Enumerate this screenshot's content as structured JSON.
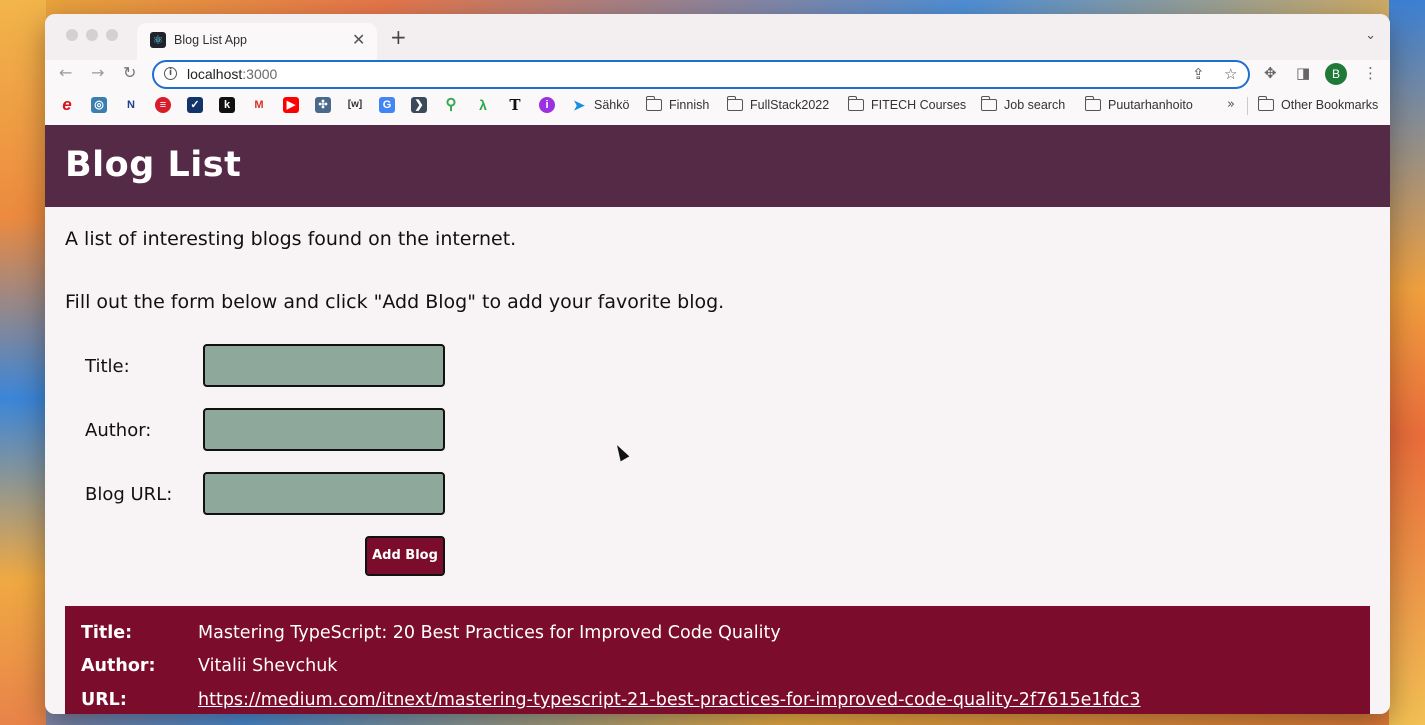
{
  "browser": {
    "tab_title": "Blog List App",
    "url_host": "localhost",
    "url_port": ":3000",
    "profile_initial": "B",
    "bookmarks": {
      "sahko": "Sähkö",
      "finnish": "Finnish",
      "fullstack": "FullStack2022",
      "fitech": "FITECH Courses",
      "job_search": "Job search",
      "puutarha": "Puutarhanhoito",
      "more": "»",
      "other": "Other Bookmarks"
    }
  },
  "page": {
    "title": "Blog List",
    "intro": "A list of interesting blogs found on the internet.",
    "instruction": "Fill out the form below and click \"Add Blog\" to add your favorite blog.",
    "form": {
      "title_label": "Title:",
      "author_label": "Author:",
      "url_label": "Blog URL:",
      "title_value": "",
      "author_value": "",
      "url_value": "",
      "submit_label": "Add Blog"
    },
    "blogs": [
      {
        "title_label": "Title:",
        "title": "Mastering TypeScript: 20 Best Practices for Improved Code Quality",
        "author_label": "Author:",
        "author": "Vitalii Shevchuk",
        "url_label": "URL:",
        "url": "https://medium.com/itnext/mastering-typescript-21-best-practices-for-improved-code-quality-2f7615e1fdc3"
      }
    ]
  },
  "colors": {
    "header_bg": "#552a47",
    "input_bg": "#8ea99b",
    "accent": "#7c0c2c"
  }
}
